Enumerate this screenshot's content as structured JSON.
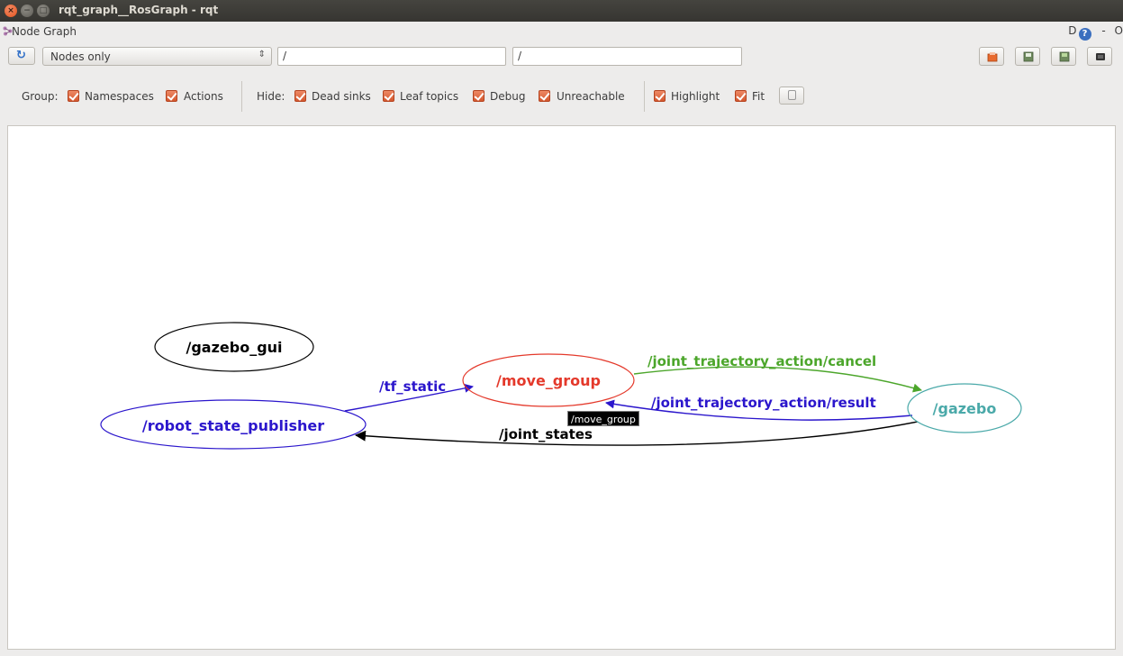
{
  "window": {
    "title": "rqt_graph__RosGraph - rqt",
    "close_glyph": "×",
    "minimize_glyph": "−",
    "maximize_glyph": "□"
  },
  "plugin": {
    "title": "Node Graph",
    "dock_labels": [
      "D",
      "?",
      "-",
      "O"
    ]
  },
  "toolbar": {
    "refresh_icon": "refresh-icon",
    "view_mode": "Nodes only",
    "view_arrow": "⇕",
    "namespace_filter": "/",
    "topic_filter": "/",
    "tool_buttons": [
      "load-dot-icon",
      "save-dot-icon",
      "save-svg-icon",
      "save-image-icon"
    ]
  },
  "options": {
    "group_label": "Group:",
    "namespaces_label": "Namespaces",
    "actions_label": "Actions",
    "hide_label": "Hide:",
    "dead_sinks_label": "Dead sinks",
    "leaf_topics_label": "Leaf topics",
    "debug_label": "Debug",
    "unreachable_label": "Unreachable",
    "highlight_label": "Highlight",
    "fit_label": "Fit",
    "checked_color": "#e46a3f"
  },
  "graph": {
    "nodes": {
      "gazebo_gui": {
        "label": "/gazebo_gui",
        "color": "#000000"
      },
      "move_group": {
        "label": "/move_group",
        "color": "#e4392b"
      },
      "robot_state_publisher": {
        "label": "/robot_state_publisher",
        "color": "#2b16cc"
      },
      "gazebo": {
        "label": "/gazebo",
        "color": "#4aa9a9"
      }
    },
    "edges": {
      "tf_static": {
        "label": "/tf_static",
        "color": "#2b16cc"
      },
      "cancel": {
        "label": "/joint_trajectory_action/cancel",
        "color": "#4ca62b"
      },
      "result": {
        "label": "/joint_trajectory_action/result",
        "color": "#2b16cc"
      },
      "joint_states": {
        "label": "/joint_states",
        "color": "#000000"
      }
    },
    "tooltip": "/move_group"
  }
}
